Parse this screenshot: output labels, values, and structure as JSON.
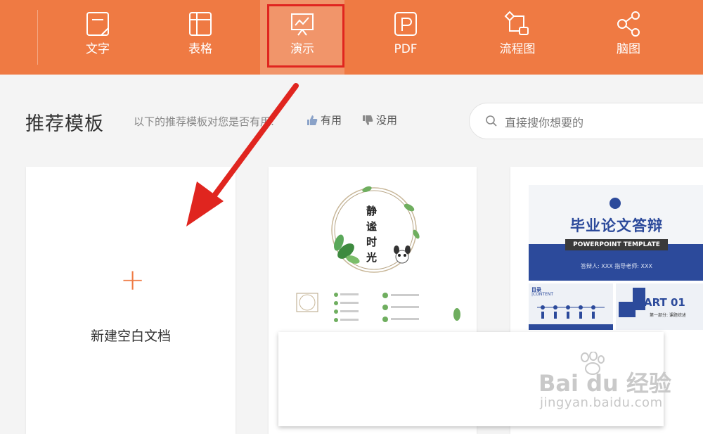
{
  "toolbar": {
    "items": [
      {
        "label": "文字",
        "icon": "doc-icon"
      },
      {
        "label": "表格",
        "icon": "table-icon"
      },
      {
        "label": "演示",
        "icon": "presentation-icon",
        "active": true
      },
      {
        "label": "PDF",
        "icon": "pdf-icon"
      },
      {
        "label": "流程图",
        "icon": "flowchart-icon"
      },
      {
        "label": "脑图",
        "icon": "mindmap-icon"
      }
    ],
    "bg_color": "#ef7a43",
    "highlight_color": "#e0251f"
  },
  "section": {
    "title": "推荐模板",
    "feedback_prompt": "以下的推荐模板对您是否有用:",
    "useful_label": "有用",
    "useless_label": "没用"
  },
  "search": {
    "placeholder": "直接搜你想要的"
  },
  "new_doc": {
    "plus": "+",
    "label": "新建空白文档"
  },
  "templates": [
    {
      "name": "wreath-template",
      "title": "静谧时光"
    },
    {
      "name": "thesis-defense-template",
      "title": "毕业论文答辩",
      "subtitle": "POWERPOINT TEMPLATE",
      "meta": "答辩人: XXX      指导老师: XXX",
      "mini_title": "目录",
      "mini_subtitle": "|CONTENT",
      "part_label": "ART 01",
      "part_text": "第一部分: 课题综述"
    }
  ],
  "watermark": {
    "brand": "Bai du 经验",
    "url": "jingyan.baidu.com"
  }
}
